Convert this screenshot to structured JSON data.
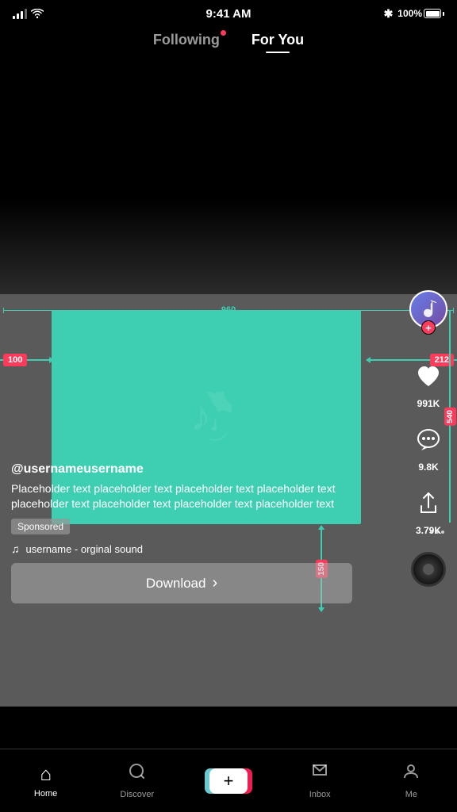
{
  "status_bar": {
    "time": "9:41 AM",
    "battery_pct": "100%"
  },
  "nav": {
    "following_label": "Following",
    "for_you_label": "For You",
    "active_tab": "for_you"
  },
  "sidebar": {
    "like_count": "991K",
    "comment_count": "9.8K",
    "share_count": "3.79K"
  },
  "measurements": {
    "width_label": "960",
    "left_margin": "100",
    "right_margin": "212",
    "height_label": "540",
    "bottom_margin": "150"
  },
  "video_info": {
    "username": "@usernameusername",
    "caption": "Placeholder text placeholder text placeholder text placeholder text placeholder text placeholder text placeholder text  placeholder text",
    "sponsored_label": "Sponsored",
    "sound_text": "username - orginal sound",
    "download_label": "Download",
    "download_chevron": "›"
  },
  "bottom_nav": {
    "home_label": "Home",
    "discover_label": "Discover",
    "inbox_label": "Inbox",
    "me_label": "Me"
  }
}
